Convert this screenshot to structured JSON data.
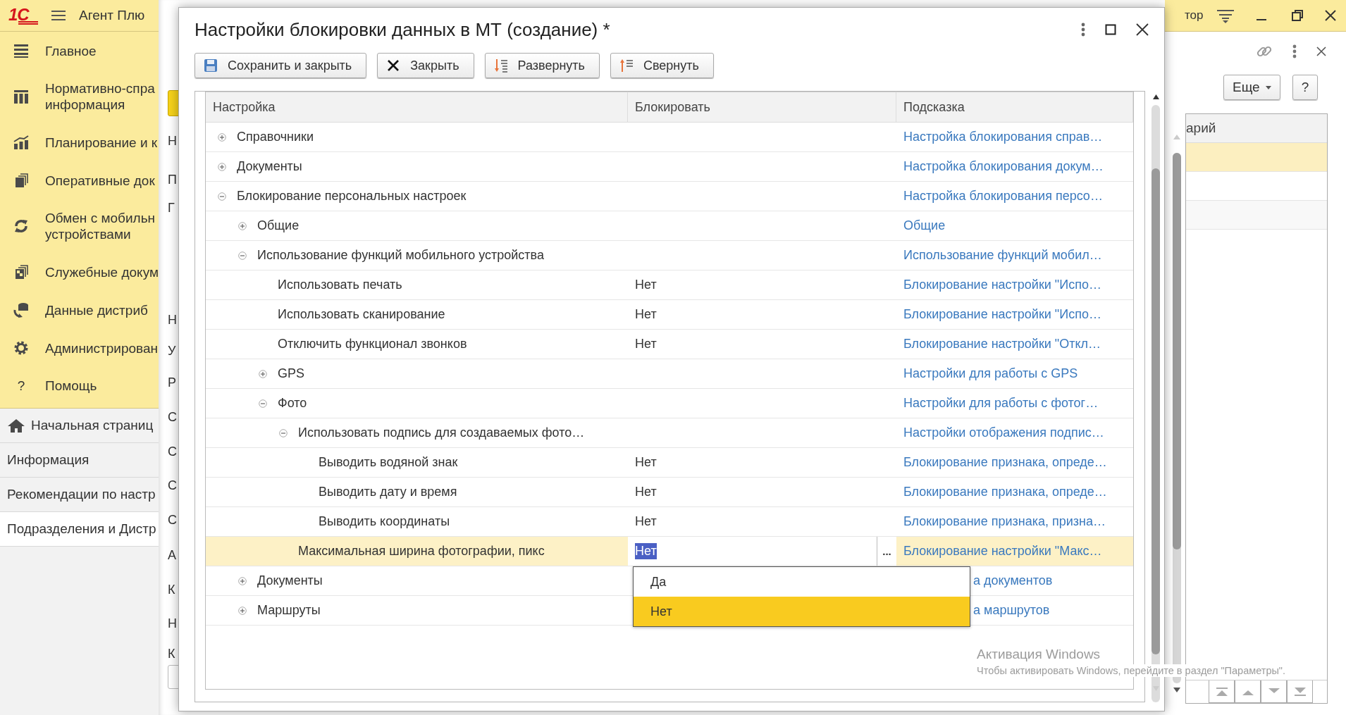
{
  "app": {
    "logo": "1С",
    "title": "Агент Плю"
  },
  "sidebar": {
    "sections": [
      {
        "label": "Главное"
      },
      {
        "label": "Нормативно-спра\nинформация"
      },
      {
        "label": "Планирование и к"
      },
      {
        "label": "Оперативные док"
      },
      {
        "label": "Обмен с мобильн\nустройствами"
      },
      {
        "label": "Служебные докум"
      },
      {
        "label": "Данные дистриб"
      },
      {
        "label": "Администрирован"
      },
      {
        "label": "Помощь",
        "icon_text": "?"
      }
    ],
    "pages": [
      {
        "label": "Начальная страниц",
        "kind": "home",
        "selected": false
      },
      {
        "label": "Информация",
        "kind": "plain",
        "selected": false
      },
      {
        "label": "Рекомендации по настр",
        "kind": "plain",
        "selected": false
      },
      {
        "label": "Подразделения и Дистр",
        "kind": "plain",
        "selected": true
      }
    ]
  },
  "background_form": {
    "labels": [
      "Н",
      "П",
      "Г",
      "Н",
      "У",
      "Р",
      "С",
      "С",
      "С",
      "С",
      "А",
      "К",
      "Н",
      "К"
    ]
  },
  "right_panel": {
    "user": "тор",
    "more_button": "Еще",
    "help_button": "?",
    "column": "арий",
    "rows": [
      {
        "selected": true
      },
      {
        "selected": false
      },
      {
        "selected": false
      }
    ]
  },
  "dialog": {
    "title": "Настройки блокировки данных в МТ (создание) *",
    "toolbar": [
      {
        "label": "Сохранить и закрыть",
        "kind": "save"
      },
      {
        "label": "Закрыть",
        "kind": "close"
      },
      {
        "label": "Развернуть",
        "kind": "expand"
      },
      {
        "label": "Свернуть",
        "kind": "collapse"
      }
    ],
    "table": {
      "columns": [
        "Настройка",
        "Блокировать",
        "Подсказка"
      ],
      "editor_button": "...",
      "rows": [
        {
          "setting": "Справочники",
          "expanded": false,
          "selected": false,
          "hint": "Настройка блокирования справ…"
        },
        {
          "setting": "Документы",
          "expanded": false,
          "selected": false,
          "hint": "Настройка блокирования докум…"
        },
        {
          "setting": "Блокирование персональных настроек",
          "expanded": true,
          "selected": false,
          "hint": "Настройка блокирования персо…",
          "children": [
            {
              "setting": "Общие",
              "expanded": false,
              "selected": false,
              "hint": "Общие"
            },
            {
              "setting": "Использование функций мобильного устройства",
              "expanded": true,
              "selected": false,
              "hint": "Использование функций мобил…",
              "children": [
                {
                  "setting": "Использовать печать",
                  "value": "Нет",
                  "selected": false,
                  "hint": "Блокирование настройки \"Испо…"
                },
                {
                  "setting": "Использовать сканирование",
                  "value": "Нет",
                  "selected": false,
                  "hint": "Блокирование настройки \"Испо…"
                },
                {
                  "setting": "Отключить функционал звонков",
                  "value": "Нет",
                  "selected": false,
                  "hint": "Блокирование настройки \"Откл…"
                },
                {
                  "setting": "GPS",
                  "expanded": false,
                  "selected": false,
                  "hint": "Настройки для работы с GPS"
                },
                {
                  "setting": "Фото",
                  "expanded": true,
                  "selected": false,
                  "hint": "Настройки для работы с фотог…",
                  "children": [
                    {
                      "setting": "Использовать подпись для создаваемых фото…",
                      "expanded": true,
                      "selected": false,
                      "hint": "Настройки отображения подпис…",
                      "children": [
                        {
                          "setting": "Выводить водяной знак",
                          "value": "Нет",
                          "selected": false,
                          "hint": "Блокирование признака, опреде…"
                        },
                        {
                          "setting": "Выводить дату и время",
                          "value": "Нет",
                          "selected": false,
                          "hint": "Блокирование признака, опреде…"
                        },
                        {
                          "setting": "Выводить координаты",
                          "value": "Нет",
                          "selected": false,
                          "hint": "Блокирование признака, призна…"
                        }
                      ]
                    },
                    {
                      "setting": "Максимальная ширина фотографии, пикс",
                      "value": "Нет",
                      "selected": true,
                      "hint": "Блокирование настройки \"Макс…"
                    }
                  ]
                }
              ]
            },
            {
              "setting": "Документы",
              "expanded": false,
              "selected": false,
              "hint": "а документов",
              "covered": true
            },
            {
              "setting": "Маршруты",
              "expanded": false,
              "selected": false,
              "hint": "а маршрутов",
              "covered": true
            }
          ]
        }
      ]
    },
    "dropdown": {
      "options": [
        {
          "label": "Да",
          "selected": false
        },
        {
          "label": "Нет",
          "selected": true
        }
      ]
    }
  },
  "activation": {
    "title": "Активация Windows",
    "text": "Чтобы активировать Windows, перейдите в раздел \"Параметры\"."
  }
}
